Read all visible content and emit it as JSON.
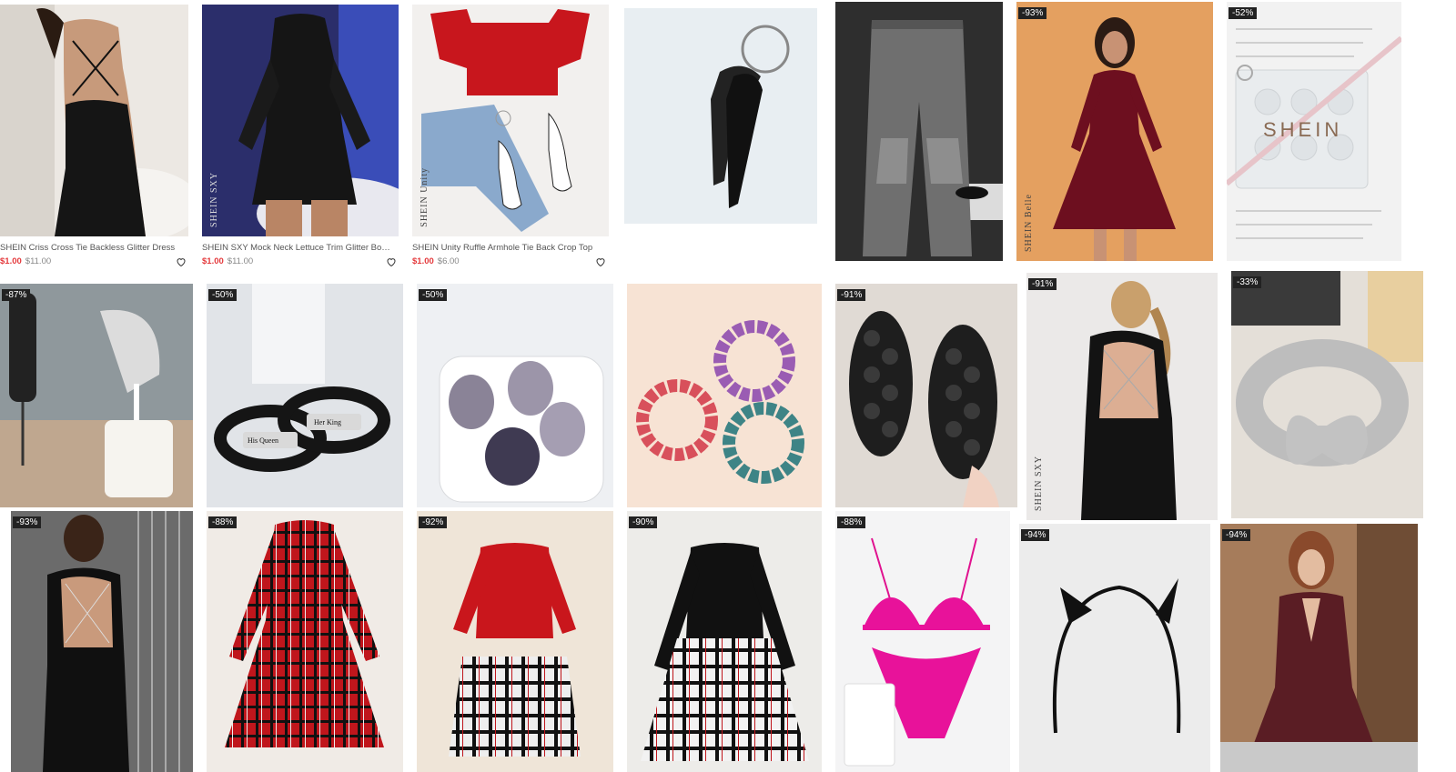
{
  "products": [
    {
      "caption": "SHEIN Criss Cross Tie Backless Glitter Dress",
      "price": "$1.00",
      "was": "$11.00",
      "watermark": ""
    },
    {
      "caption": "SHEIN SXY Mock Neck Lettuce Trim Glitter Bodycon Dress",
      "price": "$1.00",
      "was": "$11.00",
      "watermark": "SHEIN SXY"
    },
    {
      "caption": "SHEIN Unity Ruffle Armhole Tie Back Crop Top",
      "price": "$1.00",
      "was": "$6.00",
      "watermark": "SHEIN Unity"
    }
  ],
  "row1": {
    "keychain_tool": {},
    "jeans": {},
    "velvet_dress": {
      "badge": "-93%",
      "watermark": "SHEIN Belle"
    },
    "acrylic_keychain": {
      "badge": "-52%",
      "logo_text": "SHEIN"
    }
  },
  "row2": [
    {
      "badge": "-87%"
    },
    {
      "badge": "-50%",
      "bracelet_left": "His Queen",
      "bracelet_right": "Her King"
    },
    {
      "badge": "-50%"
    },
    {
      "badge": ""
    },
    {
      "badge": "-91%"
    },
    {
      "badge": "-91%",
      "watermark": "SHEIN SXY"
    },
    {
      "badge": "-33%"
    }
  ],
  "row3": [
    {
      "badge": "-93%"
    },
    {
      "badge": "-88%"
    },
    {
      "badge": "-92%"
    },
    {
      "badge": "-90%"
    },
    {
      "badge": "-88%"
    },
    {
      "badge": "-94%"
    },
    {
      "badge": "-94%"
    }
  ],
  "colors": {
    "price_accent": "#e4393c",
    "badge_bg": "#222222"
  }
}
